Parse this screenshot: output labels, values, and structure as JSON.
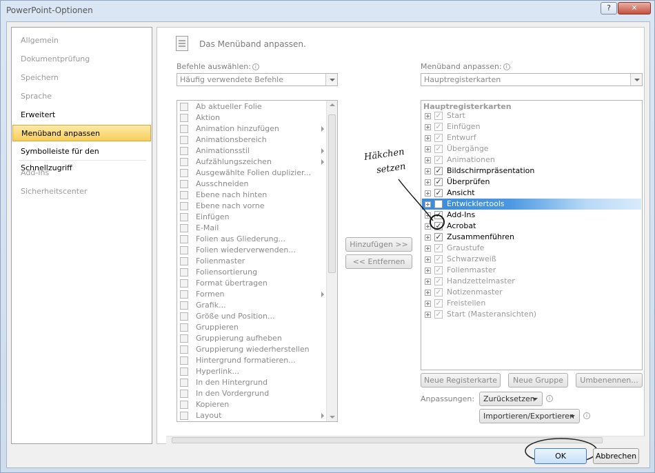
{
  "window": {
    "title": "PowerPoint-Optionen",
    "help_label": "?",
    "close_label": "✕"
  },
  "nav": {
    "items": [
      {
        "label": "Allgemein",
        "state": "dim"
      },
      {
        "label": "Dokumentprüfung",
        "state": "dim"
      },
      {
        "label": "Speichern",
        "state": "dim"
      },
      {
        "label": "Sprache",
        "state": "dim"
      },
      {
        "label": "Erweitert",
        "state": "normal"
      },
      {
        "label": "Menüband anpassen",
        "state": "selected"
      },
      {
        "label": "Symbolleiste für den Schnellzugriff",
        "state": "normal"
      },
      {
        "label": "Add-Ins",
        "state": "dim"
      },
      {
        "label": "Sicherheitscenter",
        "state": "dim"
      }
    ]
  },
  "header": {
    "title": "Das Menüband anpassen."
  },
  "commands": {
    "label": "Befehle auswählen:",
    "combo_value": "Häufig verwendete Befehle",
    "items": [
      {
        "label": "Ab aktueller Folie",
        "submenu": false
      },
      {
        "label": "Aktion",
        "submenu": false
      },
      {
        "label": "Animation hinzufügen",
        "submenu": true
      },
      {
        "label": "Animationsbereich",
        "submenu": false
      },
      {
        "label": "Animationsstil",
        "submenu": true
      },
      {
        "label": "Aufzählungszeichen",
        "submenu": true
      },
      {
        "label": "Ausgewählte Folien duplizier...",
        "submenu": false
      },
      {
        "label": "Ausschneiden",
        "submenu": false
      },
      {
        "label": "Ebene nach hinten",
        "submenu": false
      },
      {
        "label": "Ebene nach vorne",
        "submenu": false
      },
      {
        "label": "Einfügen",
        "submenu": false
      },
      {
        "label": "E-Mail",
        "submenu": false
      },
      {
        "label": "Folien aus Gliederung...",
        "submenu": false
      },
      {
        "label": "Folien wiederverwenden...",
        "submenu": false
      },
      {
        "label": "Folienmaster",
        "submenu": false
      },
      {
        "label": "Foliensortierung",
        "submenu": false
      },
      {
        "label": "Format übertragen",
        "submenu": false
      },
      {
        "label": "Formen",
        "submenu": true
      },
      {
        "label": "Grafik...",
        "submenu": false
      },
      {
        "label": "Größe und Position...",
        "submenu": false
      },
      {
        "label": "Gruppieren",
        "submenu": false
      },
      {
        "label": "Gruppierung aufheben",
        "submenu": false
      },
      {
        "label": "Gruppierung wiederherstellen",
        "submenu": false
      },
      {
        "label": "Hintergrund formatieren...",
        "submenu": false
      },
      {
        "label": "Hyperlink...",
        "submenu": false
      },
      {
        "label": "In den Hintergrund",
        "submenu": false
      },
      {
        "label": "In den Vordergrund",
        "submenu": false
      },
      {
        "label": "Kopieren",
        "submenu": false
      },
      {
        "label": "Layout",
        "submenu": true
      }
    ]
  },
  "middle_buttons": {
    "add": "Hinzufügen >>",
    "remove": "<< Entfernen"
  },
  "ribbon": {
    "label": "Menüband anpassen:",
    "combo_value": "Hauptregisterkarten",
    "tree_header": "Hauptregisterkarten",
    "tabs": [
      {
        "label": "Start",
        "checked": true,
        "state": "dim"
      },
      {
        "label": "Einfügen",
        "checked": true,
        "state": "dim"
      },
      {
        "label": "Entwurf",
        "checked": true,
        "state": "dim"
      },
      {
        "label": "Übergänge",
        "checked": true,
        "state": "dim"
      },
      {
        "label": "Animationen",
        "checked": true,
        "state": "dim"
      },
      {
        "label": "Bildschirmpräsentation",
        "checked": true,
        "state": "active"
      },
      {
        "label": "Überprüfen",
        "checked": true,
        "state": "active"
      },
      {
        "label": "Ansicht",
        "checked": true,
        "state": "active"
      },
      {
        "label": "Entwicklertools",
        "checked": false,
        "state": "selected"
      },
      {
        "label": "Add-Ins",
        "checked": true,
        "state": "active"
      },
      {
        "label": "Acrobat",
        "checked": true,
        "state": "active"
      },
      {
        "label": "Zusammenführen",
        "checked": true,
        "state": "active"
      },
      {
        "label": "Graustufe",
        "checked": true,
        "state": "dim"
      },
      {
        "label": "Schwarzweiß",
        "checked": true,
        "state": "dim"
      },
      {
        "label": "Folienmaster",
        "checked": true,
        "state": "dim"
      },
      {
        "label": "Handzettelmaster",
        "checked": true,
        "state": "dim"
      },
      {
        "label": "Notizenmaster",
        "checked": true,
        "state": "dim"
      },
      {
        "label": "Freistellen",
        "checked": true,
        "state": "dim"
      },
      {
        "label": "Start (Masteransichten)",
        "checked": true,
        "state": "dim"
      }
    ],
    "buttons": {
      "new_tab": "Neue Registerkarte",
      "new_group": "Neue Gruppe",
      "rename": "Umbenennen..."
    },
    "customizations_label": "Anpassungen:",
    "reset_label": "Zurücksetzen",
    "import_export_label": "Importieren/Exportieren"
  },
  "dialog_buttons": {
    "ok": "OK",
    "cancel": "Abbrechen"
  },
  "annotation": {
    "line1": "Häkchen",
    "line2": "setzen"
  },
  "colors": {
    "selection_yellow": "#f7cf5b",
    "selection_blue": "#3a8ad8"
  }
}
